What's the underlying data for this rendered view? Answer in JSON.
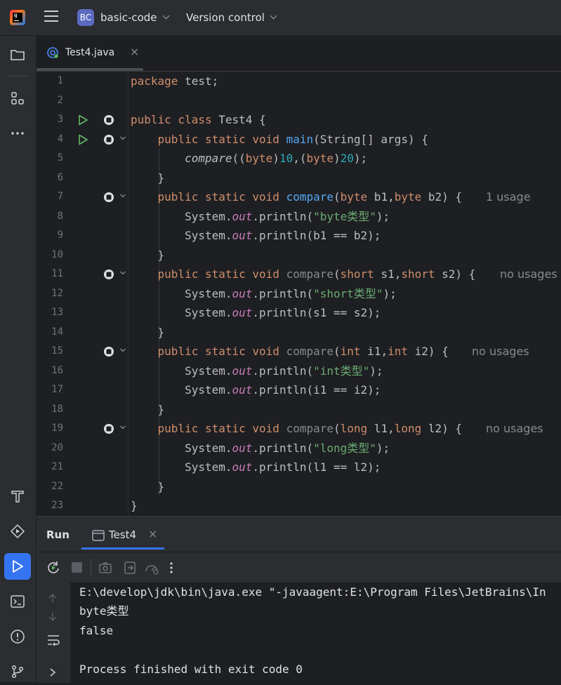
{
  "topbar": {
    "project_badge": "BC",
    "project_name": "basic-code",
    "vcs_label": "Version control"
  },
  "editor_tab": {
    "filename": "Test4.java",
    "close": "×"
  },
  "code_lines": [
    {
      "n": "1"
    },
    {
      "n": "2"
    },
    {
      "n": "3"
    },
    {
      "n": "4"
    },
    {
      "n": "5"
    },
    {
      "n": "6"
    },
    {
      "n": "7"
    },
    {
      "n": "8"
    },
    {
      "n": "9"
    },
    {
      "n": "10"
    },
    {
      "n": "11"
    },
    {
      "n": "12"
    },
    {
      "n": "13"
    },
    {
      "n": "14"
    },
    {
      "n": "15"
    },
    {
      "n": "16"
    },
    {
      "n": "17"
    },
    {
      "n": "18"
    },
    {
      "n": "19"
    },
    {
      "n": "20"
    },
    {
      "n": "21"
    },
    {
      "n": "22"
    },
    {
      "n": "23"
    }
  ],
  "code": {
    "l1": {
      "kw": "package",
      "rest": " test;"
    },
    "l3": {
      "kw": "public class",
      "rest": " Test4 {"
    },
    "l4": {
      "kw": "public static void",
      "fn": "main",
      "rest": "(String[] args) {"
    },
    "l5": {
      "call": "compare",
      "p1": "((",
      "k1": "byte",
      "p2": ")",
      "n1": "10",
      "p3": ",(",
      "k2": "byte",
      "p4": ")",
      "n2": "20",
      "p5": ");"
    },
    "l6": "}",
    "l7": {
      "kw": "public static void",
      "fn": "compare",
      "p1": "(",
      "k1": "byte",
      "a1": " b1,",
      "k2": "byte",
      "a2": " b2) {",
      "hint": "1 usage"
    },
    "l8": {
      "a": "System.",
      "out": "out",
      "b": ".println(",
      "s": "\"byte类型\"",
      "c": ");"
    },
    "l9": {
      "a": "System.",
      "out": "out",
      "b": ".println(b1 == b2);"
    },
    "l10": "}",
    "l11": {
      "kw": "public static void",
      "fn": "compare",
      "p1": "(",
      "k1": "short",
      "a1": " s1,",
      "k2": "short",
      "a2": " s2) {",
      "hint": "no usages"
    },
    "l12": {
      "a": "System.",
      "out": "out",
      "b": ".println(",
      "s": "\"short类型\"",
      "c": ");"
    },
    "l13": {
      "a": "System.",
      "out": "out",
      "b": ".println(s1 == s2);"
    },
    "l14": "}",
    "l15": {
      "kw": "public static void",
      "fn": "compare",
      "p1": "(",
      "k1": "int",
      "a1": " i1,",
      "k2": "int",
      "a2": " i2) {",
      "hint": "no usages"
    },
    "l16": {
      "a": "System.",
      "out": "out",
      "b": ".println(",
      "s": "\"int类型\"",
      "c": ");"
    },
    "l17": {
      "a": "System.",
      "out": "out",
      "b": ".println(i1 == i2);"
    },
    "l18": "}",
    "l19": {
      "kw": "public static void",
      "fn": "compare",
      "p1": "(",
      "k1": "long",
      "a1": " l1,",
      "k2": "long",
      "a2": " l2) {",
      "hint": "no usages"
    },
    "l20": {
      "a": "System.",
      "out": "out",
      "b": ".println(",
      "s": "\"long类型\"",
      "c": ");"
    },
    "l21": {
      "a": "System.",
      "out": "out",
      "b": ".println(l1 == l2);"
    },
    "l22": "}",
    "l23": "}"
  },
  "run_panel": {
    "title": "Run",
    "tab_label": "Test4",
    "tab_close": "×"
  },
  "console": {
    "lines": [
      "E:\\develop\\jdk\\bin\\java.exe \"-javaagent:E:\\Program Files\\JetBrains\\In",
      "byte类型",
      "false",
      "",
      "Process finished with exit code 0"
    ]
  },
  "colors": {
    "accent": "#3574f0",
    "keyword": "#cf8e6d",
    "function": "#56a8f5",
    "number": "#2aacb8",
    "string": "#6aab73",
    "static_field": "#c77dbb",
    "run_gutter": "#5fb865"
  },
  "icons": {
    "left_toolbar": [
      "folder-icon",
      "structure-icon",
      "more-icon",
      "build-icon",
      "services-icon",
      "run-icon",
      "terminal-icon",
      "problems-icon",
      "git-icon"
    ],
    "run_toolbar": [
      "rerun-icon",
      "stop-icon",
      "screenshot-icon",
      "exit-icon",
      "debug-icon",
      "more-vertical-icon"
    ],
    "console_side": [
      "up-arrow-icon",
      "down-arrow-icon",
      "soft-wrap-icon",
      "expand-icon"
    ]
  }
}
